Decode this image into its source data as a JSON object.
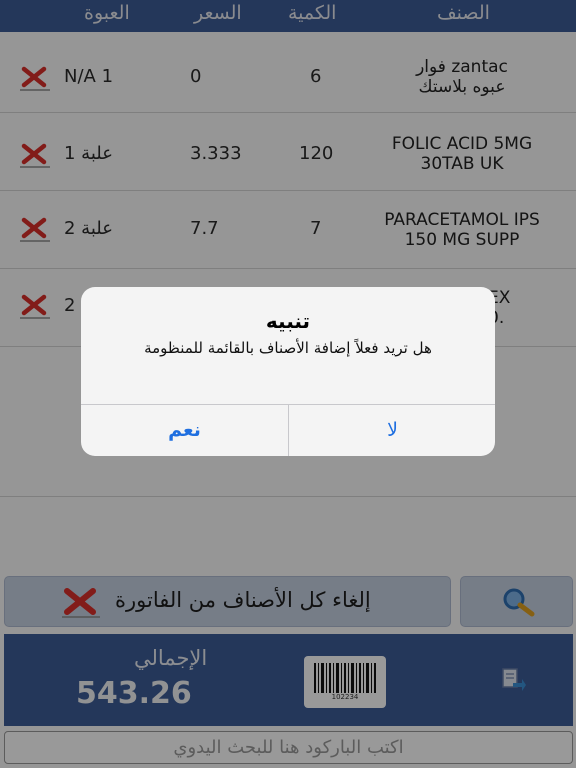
{
  "header": {
    "col_item": "الصنف",
    "col_quantity": "الكمية",
    "col_price": "السعر",
    "col_package": "العبوة"
  },
  "items": [
    {
      "name_line1": "فوار zantac",
      "name_line2": "عبوه بلاستك",
      "quantity": "6",
      "price": "0",
      "package": "N/A 1"
    },
    {
      "name_line1": "FOLIC ACID 5MG",
      "name_line2": "30TAB UK",
      "quantity": "120",
      "price": "3.333",
      "package": "علبة 1"
    },
    {
      "name_line1": "PARACETAMOL IPS",
      "name_line2": "150 MG SUPP",
      "quantity": "7",
      "price": "7.7",
      "package": "علبة 2"
    },
    {
      "name_line1": "EX",
      "name_line2": "0.",
      "quantity": "",
      "price": "",
      "package": "2"
    }
  ],
  "actions": {
    "cancel_all_label": "إلغاء كل الأصناف من الفاتورة"
  },
  "totals": {
    "label": "الإجمالي",
    "value": "543.26",
    "barcode_number": "102234"
  },
  "search": {
    "placeholder": "اكتب الباركود هنا للبحث اليدوي"
  },
  "alert": {
    "title": "تنبيه",
    "message": "هل تريد فعلاً إضافة الأصناف بالقائمة للمنظومة",
    "yes_label": "نعم",
    "no_label": "لا"
  },
  "colors": {
    "header_blue": "#3d5c96",
    "button_gray_blue": "#c5d0e1",
    "alert_button_blue": "#1f6fe0",
    "delete_red": "#d9302a"
  },
  "icons": {
    "delete": "delete-x-icon",
    "search": "magnifier-icon",
    "barcode": "barcode-icon",
    "export": "export-icon"
  }
}
